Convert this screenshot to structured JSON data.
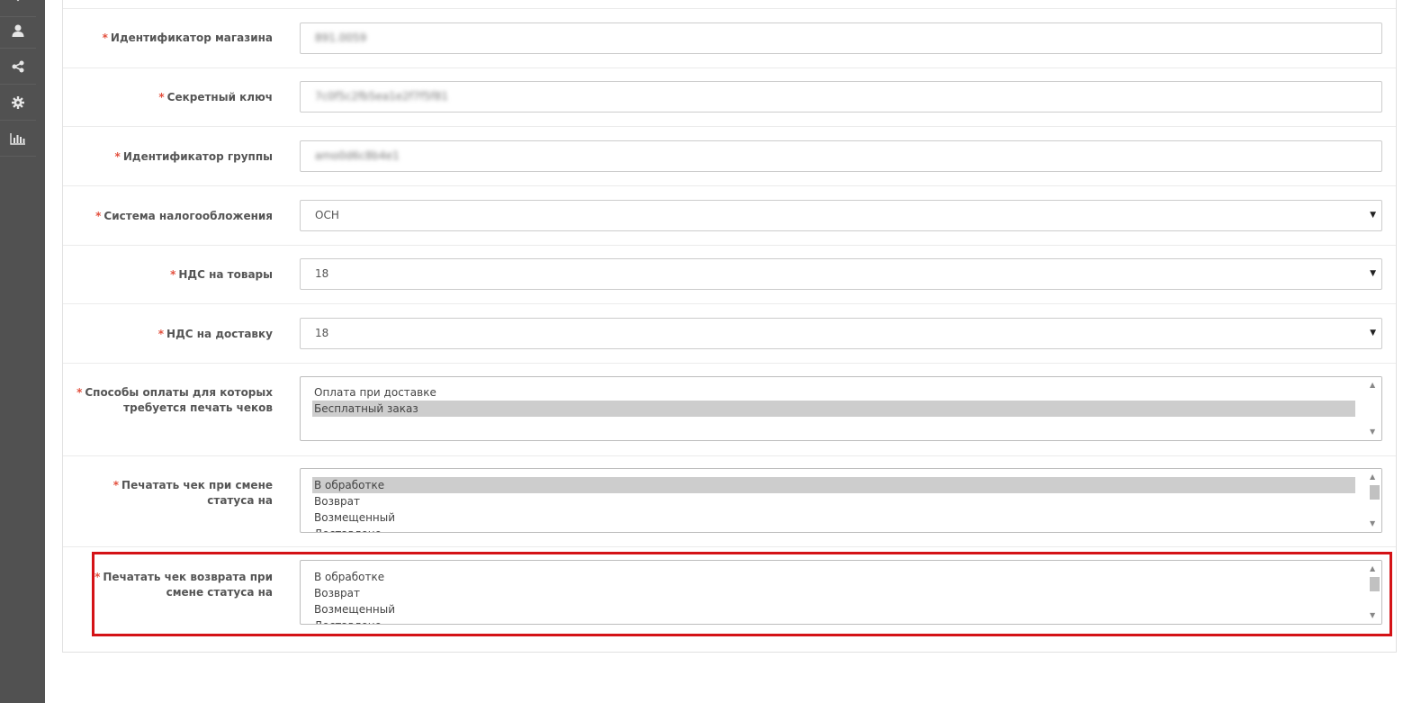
{
  "sidebar": {
    "items": [
      {
        "icon": "user-icon"
      },
      {
        "icon": "share-icon"
      },
      {
        "icon": "gear-icon"
      },
      {
        "icon": "bar-chart-icon"
      }
    ]
  },
  "form": {
    "required_mark": "*",
    "shop_id": {
      "label": "Идентификатор магазина",
      "value": "891.0059"
    },
    "secret_key": {
      "label": "Секретный ключ",
      "value": "7c0f5c2fb5ea1e2f7f5f81"
    },
    "group_id": {
      "label": "Идентификатор группы",
      "value": "amo0d6c8b4e1"
    },
    "tax_system": {
      "label": "Система налогообложения",
      "value": "ОСН"
    },
    "vat_goods": {
      "label": "НДС на товары",
      "value": "18"
    },
    "vat_delivery": {
      "label": "НДС на доставку",
      "value": "18"
    },
    "payment_methods": {
      "label": "Способы оплаты для которых требуется печать чеков",
      "options": [
        "Оплата при доставке",
        "Бесплатный заказ"
      ]
    },
    "print_on_status": {
      "label": "Печатать чек при смене статуса на",
      "options": [
        "В обработке",
        "Возврат",
        "Возмещенный",
        "Доставлено"
      ]
    },
    "print_refund_on_status": {
      "label": "Печатать чек возврата при смене статуса на",
      "options": [
        "В обработке",
        "Возврат",
        "Возмещенный",
        "Доставлено"
      ]
    }
  },
  "colors": {
    "sidebar_bg": "#515151",
    "required": "#e3503e",
    "highlight": "#d41216",
    "selected_option": "#cdcdcd"
  }
}
